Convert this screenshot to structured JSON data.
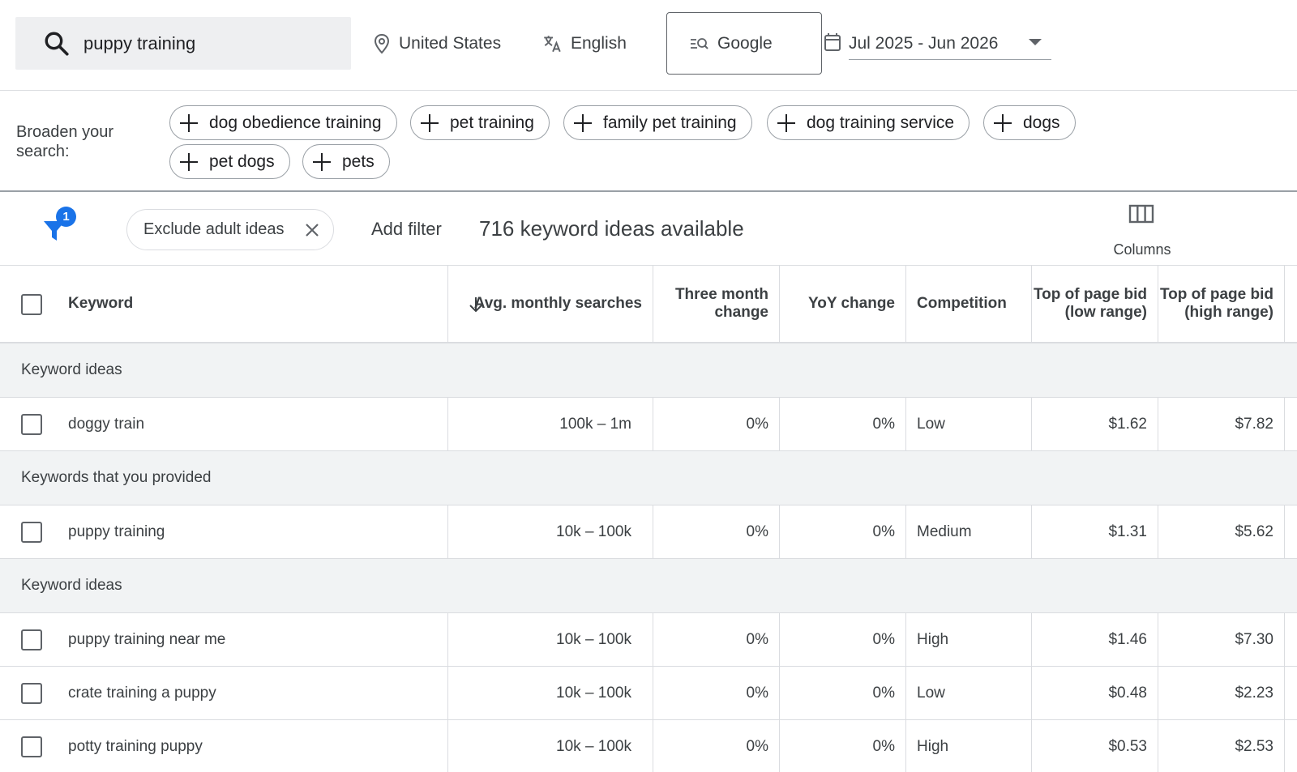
{
  "search": {
    "query": "puppy training"
  },
  "location": "United States",
  "language": "English",
  "engine": "Google",
  "date_range": "Jul 2025 - Jun 2026",
  "broaden": {
    "label": "Broaden your search:",
    "chips": [
      "dog obedience training",
      "pet training",
      "family pet training",
      "dog training service",
      "dogs",
      "pet dogs",
      "pets"
    ]
  },
  "filters": {
    "badge_count": "1",
    "exclude_chip": "Exclude adult ideas",
    "add_filter": "Add filter",
    "ideas_count": "716 keyword ideas available",
    "columns_label": "Columns"
  },
  "table": {
    "headers": {
      "keyword": "Keyword",
      "avg": "Avg. monthly searches",
      "three_month": "Three month change",
      "yoy": "YoY change",
      "competition": "Competition",
      "bid_low": "Top of page bid (low range)",
      "bid_high": "Top of page bid (high range)"
    },
    "groups": [
      {
        "label": "Keyword ideas",
        "rows": [
          {
            "keyword": "doggy train",
            "avg": "100k – 1m",
            "three_month": "0%",
            "yoy": "0%",
            "competition": "Low",
            "bid_low": "$1.62",
            "bid_high": "$7.82"
          }
        ]
      },
      {
        "label": "Keywords that you provided",
        "rows": [
          {
            "keyword": "puppy training",
            "avg": "10k – 100k",
            "three_month": "0%",
            "yoy": "0%",
            "competition": "Medium",
            "bid_low": "$1.31",
            "bid_high": "$5.62"
          }
        ]
      },
      {
        "label": "Keyword ideas",
        "rows": [
          {
            "keyword": "puppy training near me",
            "avg": "10k – 100k",
            "three_month": "0%",
            "yoy": "0%",
            "competition": "High",
            "bid_low": "$1.46",
            "bid_high": "$7.30"
          },
          {
            "keyword": "crate training a puppy",
            "avg": "10k – 100k",
            "three_month": "0%",
            "yoy": "0%",
            "competition": "Low",
            "bid_low": "$0.48",
            "bid_high": "$2.23"
          },
          {
            "keyword": "potty training puppy",
            "avg": "10k – 100k",
            "three_month": "0%",
            "yoy": "0%",
            "competition": "High",
            "bid_low": "$0.53",
            "bid_high": "$2.53"
          }
        ]
      }
    ]
  }
}
